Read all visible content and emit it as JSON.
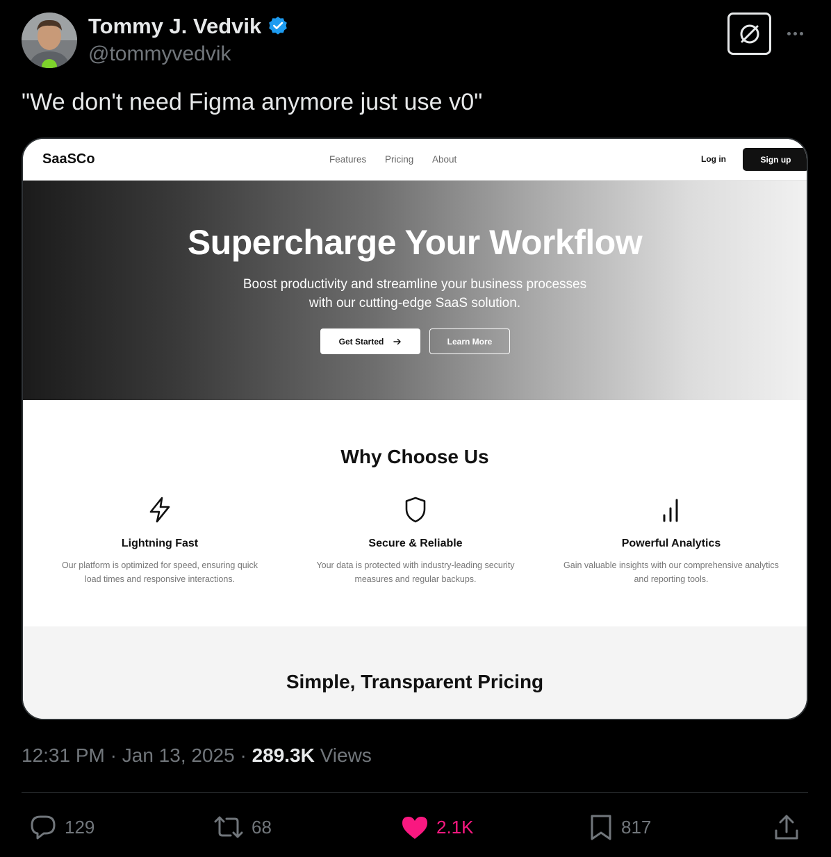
{
  "tweet": {
    "author_name": "Tommy J. Vedvik",
    "handle": "@tommyvedvik",
    "text": "\"We don't need Figma anymore just use v0\"",
    "time": "12:31 PM",
    "date": "Jan 13, 2025",
    "views_count": "289.3K",
    "views_label": "Views",
    "accent_color": "#1d9bf0",
    "like_color": "#f91880"
  },
  "actions": {
    "replies": "129",
    "reposts": "68",
    "likes": "2.1K",
    "bookmarks": "817"
  },
  "site": {
    "logo": "SaaSCo",
    "nav": [
      "Features",
      "Pricing",
      "About"
    ],
    "login": "Log in",
    "signup": "Sign up",
    "hero_title": "Supercharge Your Workflow",
    "hero_sub_line1": "Boost productivity and streamline your business processes",
    "hero_sub_line2": "with our cutting-edge SaaS solution.",
    "cta_primary": "Get Started",
    "cta_secondary": "Learn More",
    "features_title": "Why Choose Us",
    "features": [
      {
        "title": "Lightning Fast",
        "desc_line1": "Our platform is optimized for speed, ensuring quick",
        "desc_line2": "load times and responsive interactions.",
        "icon": "lightning-icon"
      },
      {
        "title": "Secure & Reliable",
        "desc_line1": "Your data is protected with industry-leading security",
        "desc_line2": "measures and regular backups.",
        "icon": "shield-icon"
      },
      {
        "title": "Powerful Analytics",
        "desc_line1": "Gain valuable insights with our comprehensive analytics",
        "desc_line2": "and reporting tools.",
        "icon": "bar-chart-icon"
      }
    ],
    "pricing_title": "Simple, Transparent Pricing"
  }
}
